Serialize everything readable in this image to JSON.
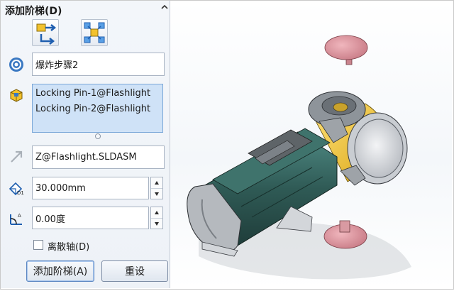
{
  "panel": {
    "title": "添加阶梯(D)",
    "collapse_icon": "chevron-up-icon",
    "tools": [
      {
        "icon": "regular-step-icon"
      },
      {
        "icon": "radial-step-icon"
      }
    ],
    "step_name": "爆炸步骤2",
    "components": [
      "Locking Pin-1@Flashlight",
      "Locking Pin-2@Flashlight"
    ],
    "direction_ref": "Z@Flashlight.SLDASM",
    "distance": "30.000mm",
    "angle": "0.00度",
    "diverge_axis_label": "离散轴(D)",
    "diverge_axis_checked": false,
    "add_step_button": "添加阶梯(A)",
    "reset_button": "重设"
  },
  "colors": {
    "body_green": "#2f5a55",
    "accent_yellow": "#f2c22e",
    "pin_pink": "#d9939c",
    "metal_gray": "#9ea3a8",
    "selection_blue": "#cfe2f7"
  }
}
